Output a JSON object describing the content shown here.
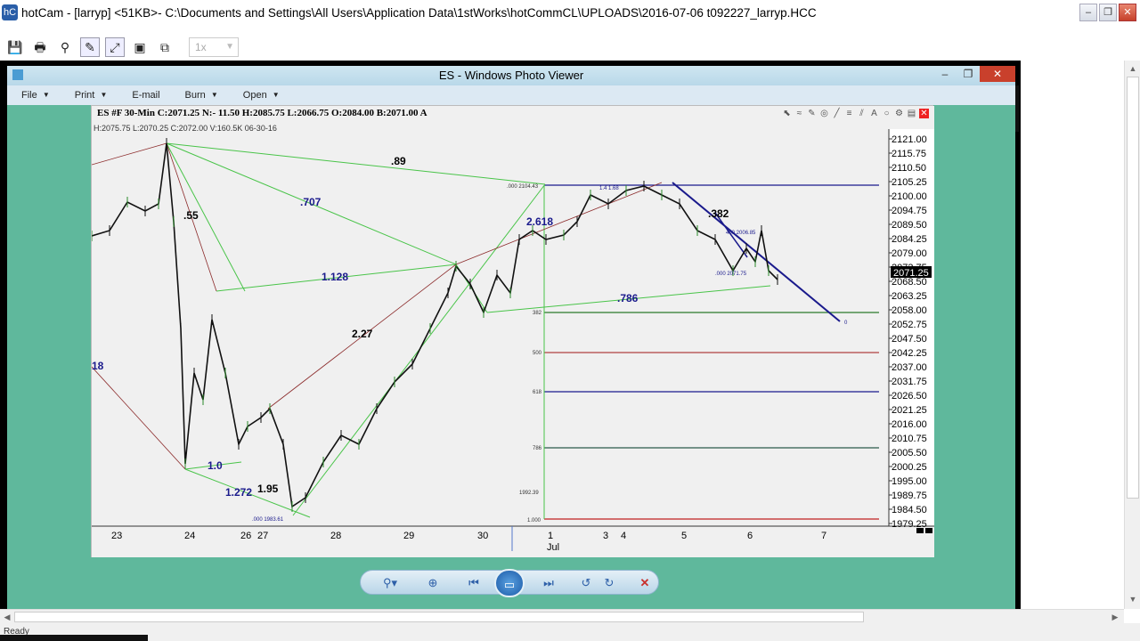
{
  "window": {
    "app_icon": "hC",
    "title": "hotCam - [larryp] <51KB>- C:\\Documents and Settings\\All Users\\Application Data\\1stWorks\\hotCommCL\\UPLOADS\\2016-07-06 t092227_larryp.HCC",
    "min_label": "–",
    "max_label": "❐",
    "close_label": "✕"
  },
  "toolbar": {
    "zoom_value": "1x"
  },
  "photo_viewer": {
    "title": "ES - Windows Photo Viewer",
    "menu": [
      "File",
      "Print",
      "E-mail",
      "Burn",
      "Open"
    ]
  },
  "chart": {
    "header": "ES #F 30-Min C:2071.25 N:- 11.50 H:2085.75 L:2066.75 O:2084.00 B:2071.00 A",
    "subheader": "H:2075.75  L:2070.25  C:2072.00  V:160.5K  06-30-16",
    "last_price": "2071.25",
    "y_ticks": [
      "2121.00",
      "2115.75",
      "2110.50",
      "2105.25",
      "2100.00",
      "2094.75",
      "2089.50",
      "2084.25",
      "2079.00",
      "2073.75",
      "2068.50",
      "2063.25",
      "2058.00",
      "2052.75",
      "2047.50",
      "2042.25",
      "2037.00",
      "2031.75",
      "2026.50",
      "2021.25",
      "2016.00",
      "2010.75",
      "2005.50",
      "2000.25",
      "1995.00",
      "1989.75",
      "1984.50",
      "1979.25"
    ],
    "x_ticks": [
      "23",
      "24",
      "26",
      "27",
      "28",
      "29",
      "30",
      "1",
      "3",
      "4",
      "5",
      "6",
      "7"
    ],
    "x_month": "Jul",
    "fib_labels": [
      ".89",
      ".707",
      ".55",
      "1.128",
      "2.27",
      "18",
      "1.0",
      "1.272",
      "1.95",
      "2.618",
      ".382",
      ".786"
    ],
    "level_labels": [
      ".000 2104.43",
      "382",
      "500",
      "618",
      "786",
      "1992.39",
      "1.000"
    ],
    "small_labels": [
      ".000 1983.61",
      ".000 2071.75",
      "450 2006.85",
      "1.4 1.68",
      "0"
    ]
  },
  "colors": {
    "green": "#5fb89c",
    "navy": "#1a1a8c",
    "fib_green": "#49c449",
    "maroon": "#8b2a2a"
  },
  "statusbar": {
    "text": "Ready"
  }
}
